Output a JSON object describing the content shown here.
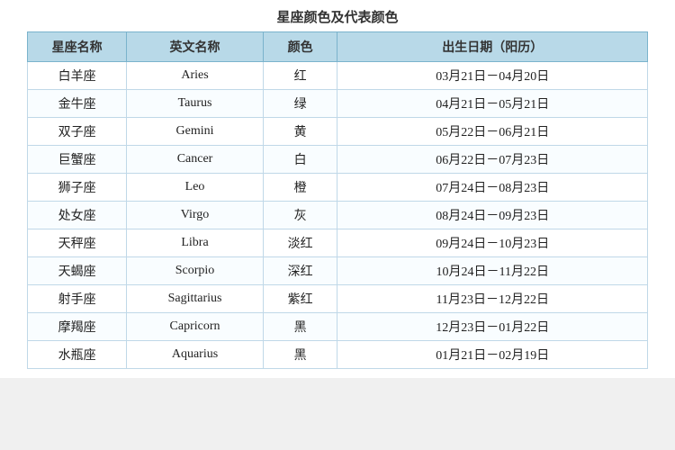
{
  "title": "星座颜色及代表颜色",
  "headers": {
    "zh_name": "星座名称",
    "en_name": "英文名称",
    "color": "颜色",
    "birth_date": "出生日期（阳历）"
  },
  "rows": [
    {
      "zh": "白羊座",
      "en": "Aries",
      "color": "红",
      "date": "03月21日－04月20日"
    },
    {
      "zh": "金牛座",
      "en": "Taurus",
      "color": "绿",
      "date": "04月21日－05月21日"
    },
    {
      "zh": "双子座",
      "en": "Gemini",
      "color": "黄",
      "date": "05月22日－06月21日"
    },
    {
      "zh": "巨蟹座",
      "en": "Cancer",
      "color": "白",
      "date": "06月22日－07月23日"
    },
    {
      "zh": "狮子座",
      "en": "Leo",
      "color": "橙",
      "date": "07月24日－08月23日"
    },
    {
      "zh": "处女座",
      "en": "Virgo",
      "color": "灰",
      "date": "08月24日－09月23日"
    },
    {
      "zh": "天秤座",
      "en": "Libra",
      "color": "淡红",
      "date": "09月24日－10月23日"
    },
    {
      "zh": "天蝎座",
      "en": "Scorpio",
      "color": "深红",
      "date": "10月24日－11月22日"
    },
    {
      "zh": "射手座",
      "en": "Sagittarius",
      "color": "紫红",
      "date": "11月23日－12月22日"
    },
    {
      "zh": "摩羯座",
      "en": "Capricorn",
      "color": "黑",
      "date": "12月23日－01月22日"
    },
    {
      "zh": "水瓶座",
      "en": "Aquarius",
      "color": "黑",
      "date": "01月21日－02月19日"
    }
  ]
}
